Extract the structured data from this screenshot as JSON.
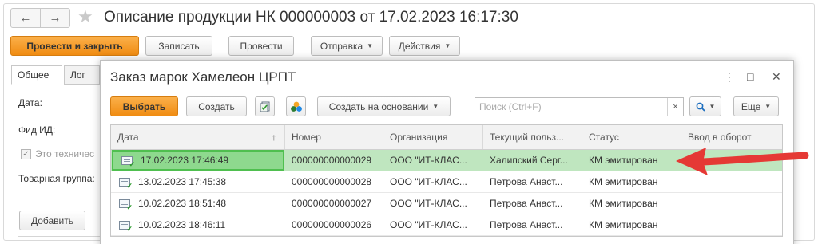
{
  "outer": {
    "title": "Описание продукции НК 000000003 от 17.02.2023 16:17:30",
    "nav": {
      "back": "←",
      "forward": "→"
    },
    "toolbar": {
      "post_close": "Провести и закрыть",
      "save": "Записать",
      "post": "Провести",
      "send": "Отправка",
      "actions": "Действия"
    },
    "tabs": [
      "Общее",
      "Лог"
    ],
    "fields": {
      "date": "Дата:",
      "fid": "Фид ИД:",
      "tech": "Это техничес",
      "group": "Товарная группа:"
    },
    "add_button": "Добавить"
  },
  "modal": {
    "title": "Заказ марок Хамелеон ЦРПТ",
    "controls": {
      "menu": "⋮",
      "maximize": "□",
      "close": "✕"
    },
    "toolbar": {
      "select": "Выбрать",
      "create": "Создать",
      "create_based": "Создать на основании",
      "more": "Еще"
    },
    "search": {
      "placeholder": "Поиск (Ctrl+F)",
      "value": "",
      "clear": "×"
    },
    "table": {
      "columns": [
        "Дата",
        "Номер",
        "Организация",
        "Текущий польз...",
        "Статус",
        "Ввод в оборот"
      ],
      "sort_indicator": "↑",
      "rows": [
        {
          "date": "17.02.2023 17:46:49",
          "number": "000000000000029",
          "org": "ООО \"ИТ-КЛАС...",
          "user": "Халипский Серг...",
          "status": "КМ эмитирован",
          "circulation": ""
        },
        {
          "date": "13.02.2023 17:45:38",
          "number": "000000000000028",
          "org": "ООО \"ИТ-КЛАС...",
          "user": "Петрова Анаст...",
          "status": "КМ эмитирован",
          "circulation": ""
        },
        {
          "date": "10.02.2023 18:51:48",
          "number": "000000000000027",
          "org": "ООО \"ИТ-КЛАС...",
          "user": "Петрова Анаст...",
          "status": "КМ эмитирован",
          "circulation": ""
        },
        {
          "date": "10.02.2023 18:46:11",
          "number": "000000000000026",
          "org": "ООО \"ИТ-КЛАС...",
          "user": "Петрова Анаст...",
          "status": "КМ эмитирован",
          "circulation": ""
        }
      ]
    }
  },
  "colors": {
    "primary_button": "#f29a1f",
    "selected_row": "#bfe6bf",
    "focused_cell": "#8ed98e",
    "annotation_arrow": "#e53935"
  }
}
